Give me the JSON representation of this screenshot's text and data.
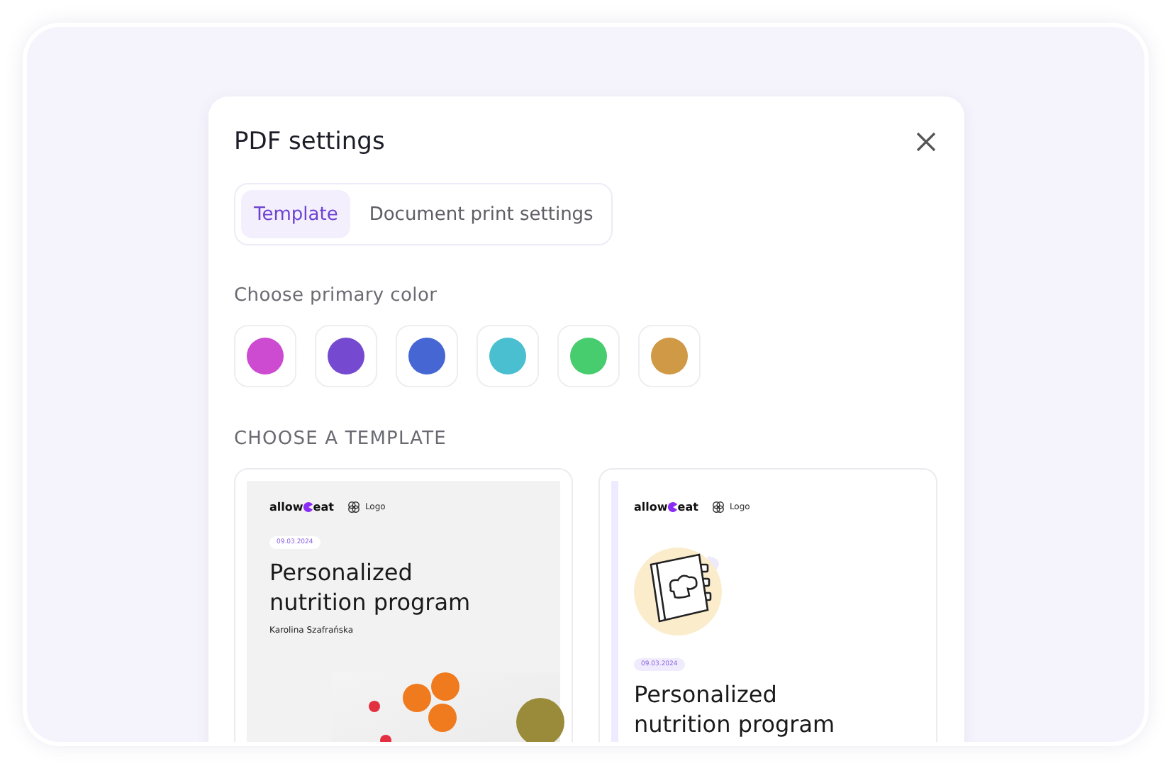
{
  "dialog": {
    "title": "PDF settings"
  },
  "tabs": [
    {
      "label": "Template",
      "selected": true
    },
    {
      "label": "Document print settings",
      "selected": false
    }
  ],
  "color_section": {
    "label": "Choose primary color",
    "swatches": [
      {
        "color": "#cc4bd1"
      },
      {
        "color": "#7549d0"
      },
      {
        "color": "#4667d3"
      },
      {
        "color": "#4abfd0"
      },
      {
        "color": "#48cd6e"
      },
      {
        "color": "#d09946"
      }
    ]
  },
  "template_section": {
    "label": "CHOOSE A TEMPLATE",
    "templates": [
      {
        "kind": "photo",
        "brand_start": "allow",
        "brand_end": "eat",
        "logo_label": "Logo",
        "date": "09.03.2024",
        "title": "Personalized nutrition program",
        "author": "Karolina Szafrańska"
      },
      {
        "kind": "illustration",
        "brand_start": "allow",
        "brand_end": "eat",
        "logo_label": "Logo",
        "date": "09.03.2024",
        "title": "Personalized nutrition program"
      }
    ]
  }
}
